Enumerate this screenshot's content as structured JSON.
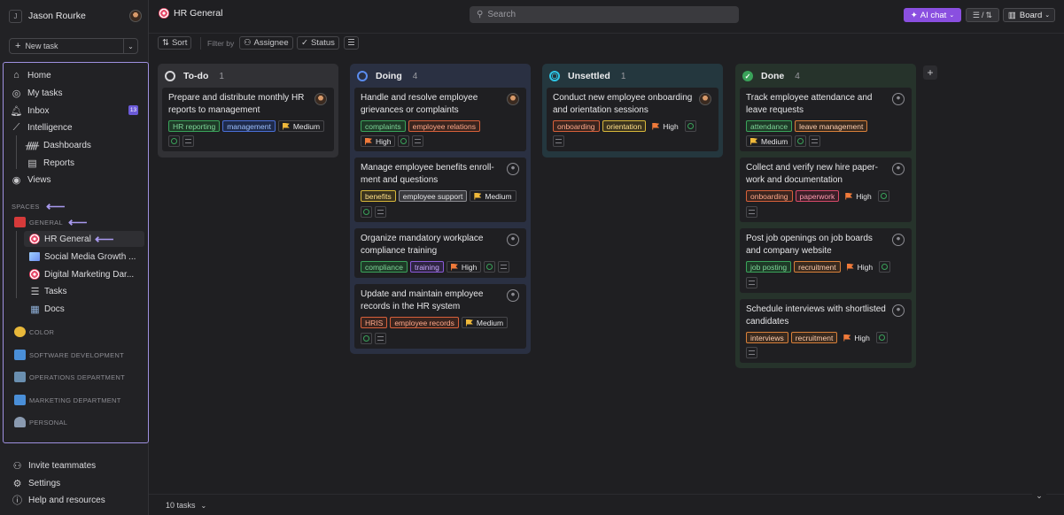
{
  "user": {
    "initial": "J",
    "name": "Jason Rourke"
  },
  "new_task": {
    "label": "New task",
    "plus": "+",
    "chevron": "⌄"
  },
  "nav": {
    "home": "Home",
    "my_tasks": "My tasks",
    "inbox": "Inbox",
    "inbox_count": "13",
    "intelligence": "Intelligence",
    "dashboards": "Dashboards",
    "reports": "Reports",
    "views": "Views"
  },
  "spaces": {
    "header": "SPACES",
    "general": "GENERAL",
    "hr_general": "HR General",
    "social_media": "Social Media Growth ...",
    "digital_marketing": "Digital Marketing Dar...",
    "tasks": "Tasks",
    "docs": "Docs",
    "color": "COLOR",
    "software_dev": "SOFTWARE DEVELOPMENT",
    "operations": "OPERATIONS DEPARTMENT",
    "marketing": "MARKETING DEPARTMENT",
    "personal": "PERSONAL"
  },
  "bottom_nav": {
    "invite": "Invite teammates",
    "settings": "Settings",
    "help": "Help and resources"
  },
  "header": {
    "title": "HR General",
    "search_placeholder": "Search",
    "ai_chat": "AI chat",
    "filter_sort": "/",
    "board": "Board"
  },
  "toolbar": {
    "sort": "Sort",
    "filter_by": "Filter by",
    "assignee": "Assignee",
    "status": "Status"
  },
  "colors": {
    "accent": "#8a4fe0",
    "todo": "#d6d6d9",
    "doing": "#5b8def",
    "unsettled": "#2ec6e6",
    "done": "#3aa35a",
    "high": "#f07a3a",
    "medium": "#f0b93a"
  },
  "columns": [
    {
      "name": "To-do",
      "count": "1",
      "cards": [
        {
          "title": "Prepare and distribute monthly HR reports to management",
          "tags": [
            "HR reporting",
            "management"
          ],
          "priority": "Medium"
        }
      ]
    },
    {
      "name": "Doing",
      "count": "4",
      "cards": [
        {
          "title": "Handle and resolve employee grievances or complaints",
          "tags": [
            "complaints",
            "employee relations"
          ],
          "priority": "High"
        },
        {
          "title": "Manage employee benefits enroll­ment and questions",
          "tags": [
            "benefits",
            "employee support"
          ],
          "priority": "Medium"
        },
        {
          "title": "Organize mandatory workplace compliance training",
          "tags": [
            "compliance",
            "training"
          ],
          "priority": "High"
        },
        {
          "title": "Update and maintain employee records in the HR system",
          "tags": [
            "HRIS",
            "employee records"
          ],
          "priority": "Medium"
        }
      ]
    },
    {
      "name": "Unsettled",
      "count": "1",
      "cards": [
        {
          "title": "Conduct new employee onboard­ing and orientation sessions",
          "tags": [
            "onboarding",
            "orientation"
          ],
          "priority": "High"
        }
      ]
    },
    {
      "name": "Done",
      "count": "4",
      "cards": [
        {
          "title": "Track employee attendance and leave requests",
          "tags": [
            "attendance",
            "leave management"
          ],
          "priority": "Medium"
        },
        {
          "title": "Collect and verify new hire paper­work and documentation",
          "tags": [
            "onboarding",
            "paperwork"
          ],
          "priority": "High"
        },
        {
          "title": "Post job openings on job boards and company website",
          "tags": [
            "job posting",
            "recruitment"
          ],
          "priority": "High"
        },
        {
          "title": "Schedule interviews with short­listed candidates",
          "tags": [
            "interviews",
            "recruitment"
          ],
          "priority": "High"
        }
      ]
    }
  ],
  "footer": {
    "task_count": "10 tasks"
  }
}
